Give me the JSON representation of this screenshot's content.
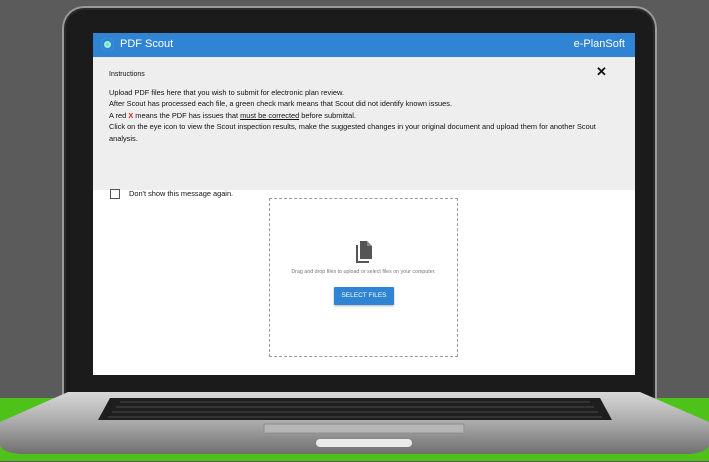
{
  "app": {
    "title": "PDF Scout",
    "brand": "e-PlanSoft"
  },
  "instructions": {
    "heading": "Instructions",
    "line1": "Upload PDF files here that you wish to submit for electronic plan review.",
    "line2": "After Scout has processed each file, a green check mark means that Scout did not identify known issues.",
    "line3_pre": "A red ",
    "line3_x": "X",
    "line3_mid": " means the PDF has issues that ",
    "line3_underline": "must be corrected",
    "line3_post": " before submittal.",
    "line4": "Click on the eye icon to view the Scout inspection results, make the suggested changes in your original document and upload them for another Scout analysis.",
    "dont_show": "Don't show this message again."
  },
  "upload": {
    "hint": "Drag and drop files to upload or select files on your computer.",
    "button": "SELECT FILES"
  },
  "colors": {
    "accent": "#2f84d3",
    "panel": "#eeeeee",
    "error": "#e0241f",
    "background": "#5a5a5a",
    "green": "#4fc21a"
  },
  "icons": [
    "app-logo-icon",
    "close-icon",
    "file-copy-icon"
  ]
}
